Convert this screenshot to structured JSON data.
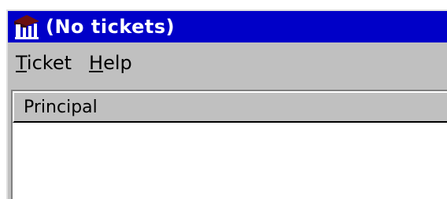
{
  "window": {
    "title": "(No tickets)",
    "icon": "kerberos-tickets-icon"
  },
  "menubar": {
    "items": [
      {
        "accel": "T",
        "rest": "icket"
      },
      {
        "accel": "H",
        "rest": "elp"
      }
    ]
  },
  "list": {
    "columns": [
      "Principal"
    ],
    "rows": []
  },
  "colors": {
    "titlebar": "#0000c8",
    "window_face": "#c0c0c0",
    "list_background": "#ffffff"
  }
}
